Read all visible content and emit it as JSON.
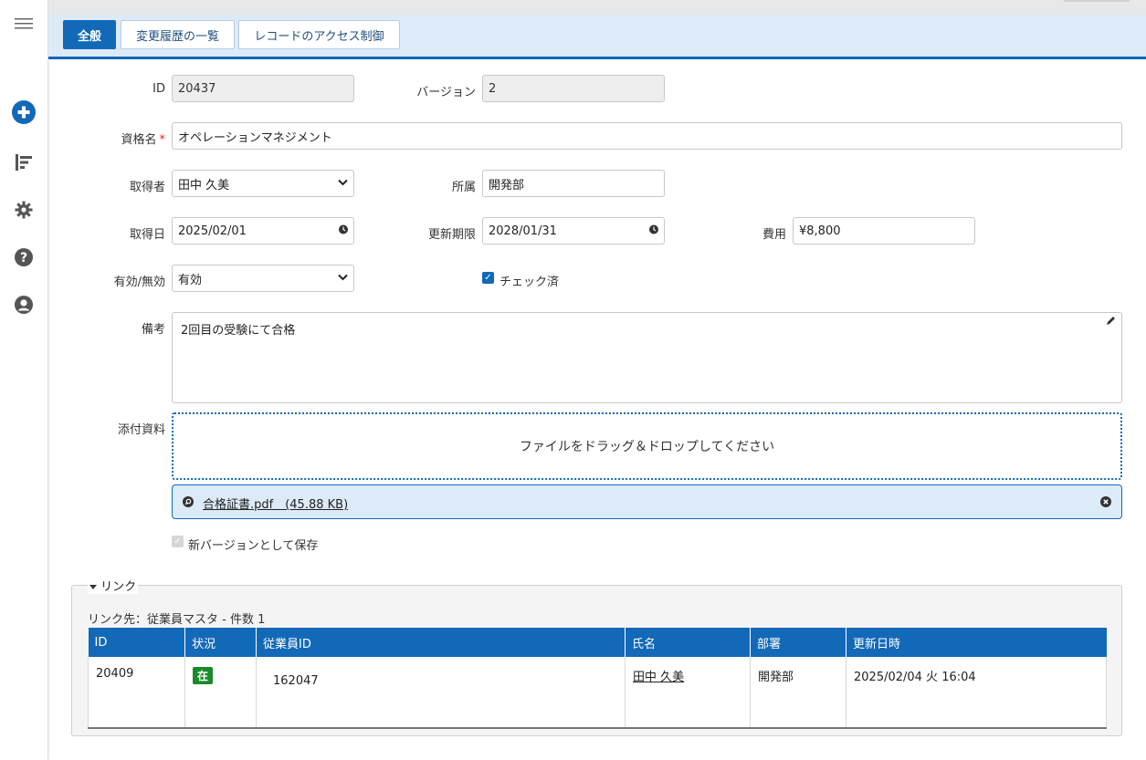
{
  "tabs": [
    {
      "label": "全般"
    },
    {
      "label": "変更履歴の一覧"
    },
    {
      "label": "レコードのアクセス制御"
    }
  ],
  "sidebar": {
    "icons": [
      "menu-icon",
      "add-icon",
      "sort-icon",
      "gear-icon",
      "help-icon",
      "user-icon"
    ]
  },
  "form": {
    "id_label": "ID",
    "id_value": "20437",
    "version_label": "バージョン",
    "version_value": "2",
    "name_label": "資格名",
    "name_value": "オペレーションマネジメント",
    "required_mark": "*",
    "holder_label": "取得者",
    "holder_value": "田中 久美",
    "dept_label": "所属",
    "dept_value": "開発部",
    "acquired_label": "取得日",
    "acquired_value": "2025/02/01",
    "expiry_label": "更新期限",
    "expiry_value": "2028/01/31",
    "cost_label": "費用",
    "cost_value": "¥8,800",
    "valid_label": "有効/無効",
    "valid_value": "有効",
    "checked_label": "チェック済",
    "notes_label": "備考",
    "notes_value": "2回目の受験にて合格",
    "attach_label": "添付資料",
    "dropzone_text": "ファイルをドラッグ＆ドロップしてください",
    "attachment_name": "合格証書.pdf　(45.88 KB)",
    "save_version_label": "新バージョンとして保存"
  },
  "links": {
    "legend": "リンク",
    "caption": "リンク先：従業員マスタ - 件数 1",
    "columns": [
      "ID",
      "状況",
      "従業員ID",
      "氏名",
      "部署",
      "更新日時"
    ],
    "row": {
      "id": "20409",
      "status": "在",
      "employee_id": "162047",
      "name": "田中 久美",
      "dept": "開発部",
      "updated": "2025/02/04 火 16:04"
    }
  },
  "colors": {
    "accent": "#1269b8",
    "tab_bar": "#ddeaf7",
    "badge": "#1a8a2a"
  }
}
